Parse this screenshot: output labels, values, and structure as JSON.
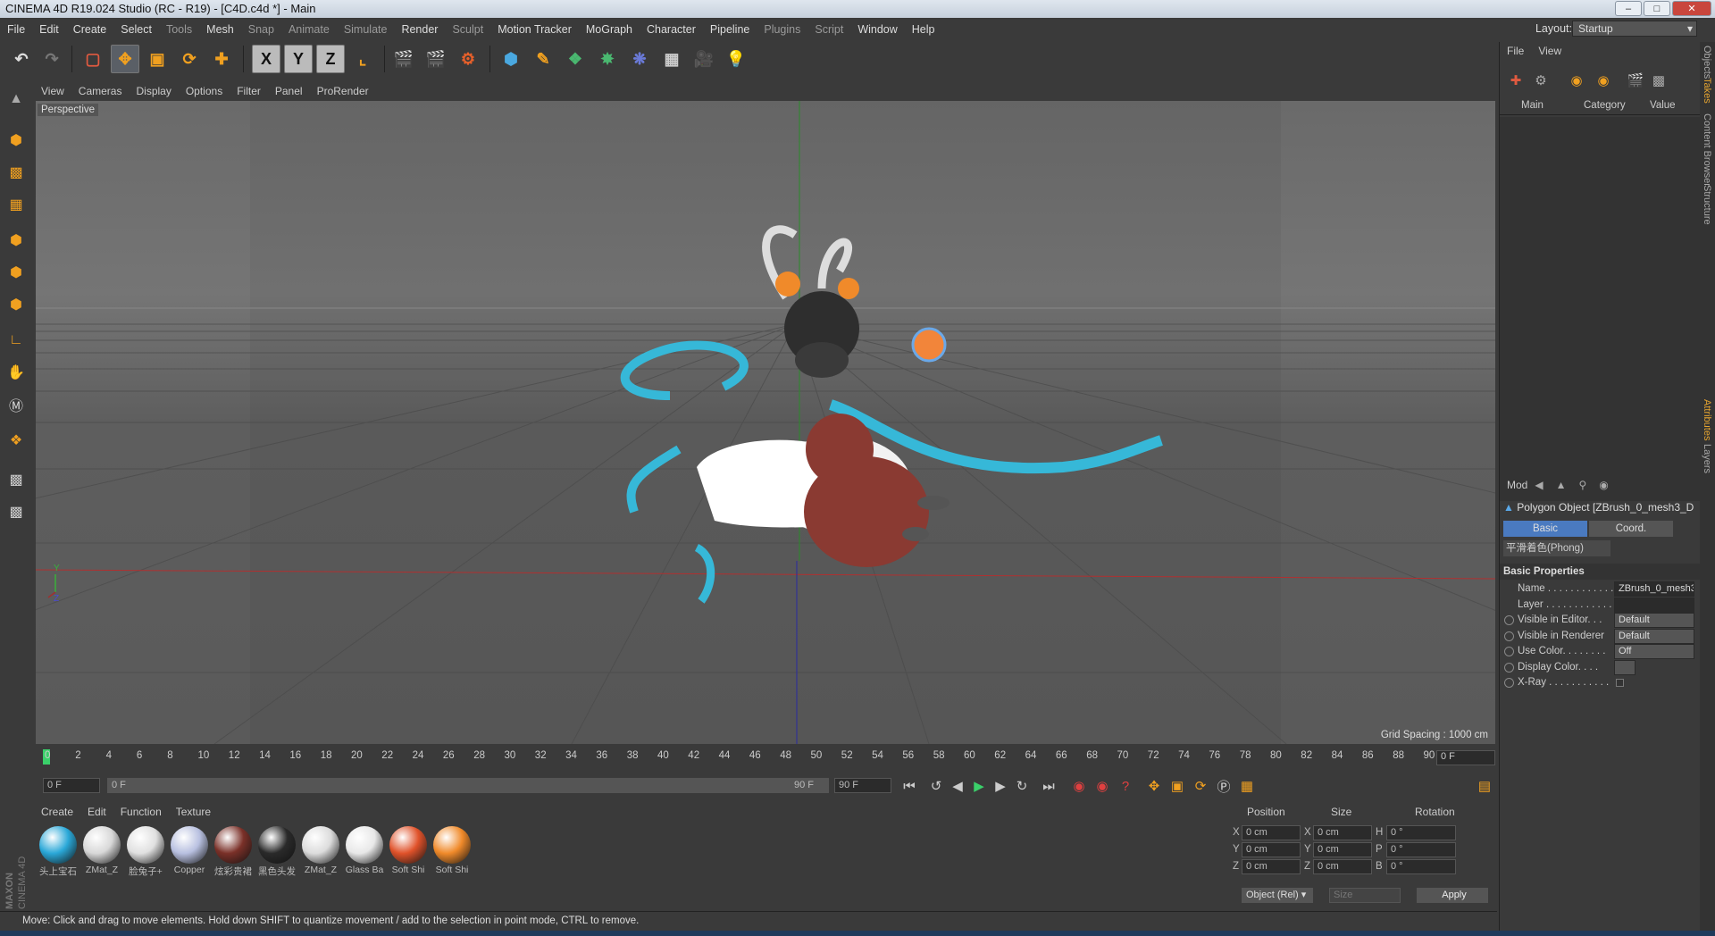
{
  "window": {
    "title": "CINEMA 4D R19.024 Studio (RC - R19) - [C4D.c4d *] - Main"
  },
  "menu": [
    "File",
    "Edit",
    "Create",
    "Select",
    "Tools",
    "Mesh",
    "Snap",
    "Animate",
    "Simulate",
    "Render",
    "Sculpt",
    "Motion Tracker",
    "MoGraph",
    "Character",
    "Pipeline",
    "Plugins",
    "Script",
    "Window",
    "Help"
  ],
  "layout": {
    "label": "Layout:",
    "value": "Startup"
  },
  "viewport": {
    "menu": [
      "View",
      "Cameras",
      "Display",
      "Options",
      "Filter",
      "Panel",
      "ProRender"
    ],
    "label": "Perspective",
    "grid_spacing": "Grid Spacing : 1000 cm"
  },
  "timeline": {
    "ticks": [
      "0",
      "2",
      "4",
      "6",
      "8",
      "10",
      "12",
      "14",
      "16",
      "18",
      "20",
      "22",
      "24",
      "26",
      "28",
      "30",
      "32",
      "34",
      "36",
      "38",
      "40",
      "42",
      "44",
      "46",
      "48",
      "50",
      "52",
      "54",
      "56",
      "58",
      "60",
      "62",
      "64",
      "66",
      "68",
      "70",
      "72",
      "74",
      "76",
      "78",
      "80",
      "82",
      "84",
      "86",
      "88",
      "90"
    ],
    "frame_end": "0 F",
    "start_field": "0 F",
    "range_left": "0 F",
    "range_right": "90 F",
    "end_field": "90 F"
  },
  "materials": {
    "menu": [
      "Create",
      "Edit",
      "Function",
      "Texture"
    ],
    "items": [
      {
        "label": "头上宝石",
        "color": "#2aa8d8"
      },
      {
        "label": "ZMat_Z",
        "color": "#d8d8d8"
      },
      {
        "label": "脸兔子+",
        "color": "#e0e0e0"
      },
      {
        "label": "Copper",
        "color": "#b8c0e0"
      },
      {
        "label": "炫彩贵裙",
        "color": "#7a3028"
      },
      {
        "label": "黑色头发",
        "color": "#2a2a2a"
      },
      {
        "label": "ZMat_Z",
        "color": "#dcdcdc"
      },
      {
        "label": "Glass Ba",
        "color": "#e8e8e8"
      },
      {
        "label": "Soft Shi",
        "color": "#e0522a"
      },
      {
        "label": "Soft Shi",
        "color": "#f08a2a"
      }
    ]
  },
  "coords": {
    "headers": [
      "Position",
      "Size",
      "Rotation"
    ],
    "rows": [
      {
        "a": "X",
        "pos": "0 cm",
        "b": "X",
        "size": "0 cm",
        "c": "H",
        "rot": "0 °"
      },
      {
        "a": "Y",
        "pos": "0 cm",
        "b": "Y",
        "size": "0 cm",
        "c": "P",
        "rot": "0 °"
      },
      {
        "a": "Z",
        "pos": "0 cm",
        "b": "Z",
        "size": "0 cm",
        "c": "B",
        "rot": "0 °"
      }
    ],
    "mode": "Object (Rel)",
    "size_mode": "Size",
    "apply": "Apply"
  },
  "status": "Move: Click and drag to move elements. Hold down SHIFT to quantize movement / add to the selection in point mode, CTRL to remove.",
  "objects": {
    "menu": [
      "File",
      "View"
    ],
    "columns": [
      "Main",
      "Category",
      "Value"
    ]
  },
  "attributes": {
    "mode": "Mod",
    "title": "Polygon Object [ZBrush_0_mesh3_D",
    "tabs": [
      "Basic",
      "Coord."
    ],
    "phong": "平滑着色(Phong)",
    "section": "Basic Properties",
    "props": [
      {
        "label": "Name . . . . . . . . . . . .",
        "value": "ZBrush_0_mesh3"
      },
      {
        "label": "Layer . . . . . . . . . . . .",
        "value": ""
      },
      {
        "label": "Visible in Editor. . .",
        "value": "Default"
      },
      {
        "label": "Visible in Renderer",
        "value": "Default"
      },
      {
        "label": "Use Color. . . . . . . .",
        "value": "Off"
      },
      {
        "label": "Display Color. . . .",
        "value": ""
      },
      {
        "label": "X-Ray . . . . . . . . . . .",
        "value": ""
      }
    ]
  },
  "sidetabs": [
    "Objects",
    "Takes",
    "Content Browser",
    "Structure",
    "Attributes",
    "Layers"
  ],
  "brand": "MAXON CINEMA 4D"
}
